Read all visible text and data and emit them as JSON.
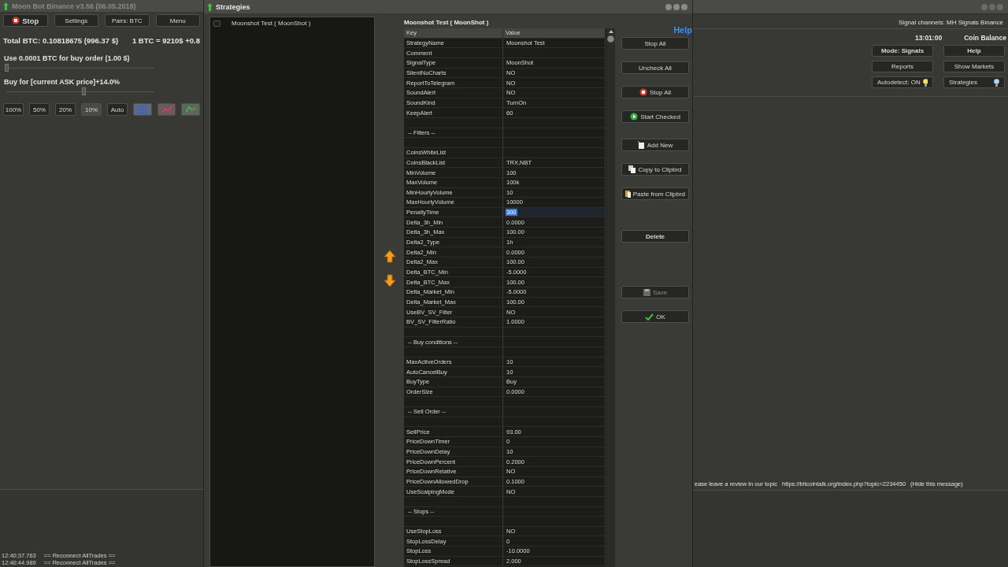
{
  "main_window": {
    "title": "Moon Bot Binance v3.56 (06.05.2018)",
    "toolbar": [
      {
        "label": "Stop",
        "kind": "stop"
      },
      {
        "label": "Settings",
        "kind": "plain"
      },
      {
        "label": "Pairs: BTC",
        "kind": "plain"
      },
      {
        "label": "Menu",
        "kind": "plain"
      }
    ],
    "total_btc": "Total BTC: 0.10818675 (996.37 $)",
    "btc_price": "1 BTC = 9210$  +0.8",
    "sliders": [
      {
        "label": "Use 0.0001 BTC for buy order  (1.00 $)",
        "level": 0.0
      },
      {
        "label": "Buy for [current ASK price]+14.0%",
        "level": 0.52
      }
    ],
    "percent_buttons": [
      {
        "label": "100%",
        "selected": false
      },
      {
        "label": "50%",
        "selected": false
      },
      {
        "label": "20%",
        "selected": false
      },
      {
        "label": "10%",
        "selected": true
      },
      {
        "label": "Auto",
        "selected": false
      }
    ],
    "log": [
      {
        "time": "12:40:37.763",
        "message": "== Reconnect AllTrades =="
      },
      {
        "time": "12:40:44.989",
        "message": "== Reconnect AllTrades =="
      }
    ],
    "signal_channels": "Signal channels: MH Signals Binance",
    "clock": "13:01:00",
    "coin_balance": "Coin Balance",
    "side_buttons": [
      {
        "label": "Mode: Signals",
        "bold": true,
        "kind": "plain"
      },
      {
        "label": "Help",
        "bold": true,
        "kind": "plain"
      },
      {
        "label": "Reports",
        "bold": false,
        "kind": "plain"
      },
      {
        "label": "Show Markets",
        "bold": false,
        "kind": "plain"
      },
      {
        "label": "Autodetect: ON",
        "bold": false,
        "kind": "bulb",
        "color": "#f3de6a"
      },
      {
        "label": "Strategies",
        "bold": false,
        "kind": "bulb",
        "color": "#a9d4f5"
      }
    ],
    "notice": {
      "text": "ease leave a review in our topic",
      "link": "https://bitcointalk.org/index.php?topic=2234450",
      "hide": "(Hide this message)"
    }
  },
  "strategies_window": {
    "title": "Strategies",
    "strategies": [
      {
        "name": "Moonshot Test  ( MoonShot )",
        "checked": false
      }
    ],
    "heading": "Moonshot Test  ( MoonShot )",
    "help": "Help",
    "table": {
      "columns": [
        "Key",
        "Value"
      ],
      "rows": [
        {
          "kind": "param",
          "key": "StrategyName",
          "value": "Moonshot Test",
          "selected": false
        },
        {
          "kind": "param",
          "key": "Comment",
          "selected": false
        },
        {
          "kind": "param",
          "key": "SignalType",
          "value": "MoonShot",
          "selected": false
        },
        {
          "kind": "param",
          "key": "SilentNoCharts",
          "value": "NO",
          "selected": false
        },
        {
          "kind": "param",
          "key": "ReportToTelegram",
          "value": "NO",
          "selected": false
        },
        {
          "kind": "param",
          "key": "SoundAlert",
          "value": "NO",
          "selected": false
        },
        {
          "kind": "param",
          "key": "SoundKind",
          "value": "TurnOn",
          "selected": false
        },
        {
          "kind": "param",
          "key": "KeepAlert",
          "value": "60",
          "selected": false
        },
        {
          "kind": "blank"
        },
        {
          "kind": "section",
          "key": "-- Filters --"
        },
        {
          "kind": "blank"
        },
        {
          "kind": "param",
          "key": "CoinsWhiteList",
          "selected": false
        },
        {
          "kind": "param",
          "key": "CoinsBlackList",
          "value": "TRX,NBT",
          "selected": false
        },
        {
          "kind": "param",
          "key": "MinVolume",
          "value": "100",
          "selected": false
        },
        {
          "kind": "param",
          "key": "MaxVolume",
          "value": "100k",
          "selected": false
        },
        {
          "kind": "param",
          "key": "MinHourlyVolume",
          "value": "10",
          "selected": false
        },
        {
          "kind": "param",
          "key": "MaxHourlyVolume",
          "value": "10000",
          "selected": false
        },
        {
          "kind": "param",
          "key": "PenaltyTime",
          "value": "300",
          "selected": true
        },
        {
          "kind": "param",
          "key": "Delta_3h_Min",
          "value": "0.0000",
          "selected": false
        },
        {
          "kind": "param",
          "key": "Delta_3h_Max",
          "value": "100.00",
          "selected": false
        },
        {
          "kind": "param",
          "key": "Delta2_Type",
          "value": "1h",
          "selected": false
        },
        {
          "kind": "param",
          "key": "Delta2_Min",
          "value": "0.0000",
          "selected": false
        },
        {
          "kind": "param",
          "key": "Delta2_Max",
          "value": "100.00",
          "selected": false
        },
        {
          "kind": "param",
          "key": "Delta_BTC_Min",
          "value": "-5.0000",
          "selected": false
        },
        {
          "kind": "param",
          "key": "Delta_BTC_Max",
          "value": "100.00",
          "selected": false
        },
        {
          "kind": "param",
          "key": "Delta_Market_Min",
          "value": "-5.0000",
          "selected": false
        },
        {
          "kind": "param",
          "key": "Delta_Market_Max",
          "value": "100.00",
          "selected": false
        },
        {
          "kind": "param",
          "key": "UseBV_SV_Filter",
          "value": "NO",
          "selected": false
        },
        {
          "kind": "param",
          "key": "BV_SV_FilterRatio",
          "value": "1.0000",
          "selected": false
        },
        {
          "kind": "blank"
        },
        {
          "kind": "section",
          "key": "-- Buy conditions --"
        },
        {
          "kind": "blank"
        },
        {
          "kind": "param",
          "key": "MaxActiveOrders",
          "value": "10",
          "selected": false
        },
        {
          "kind": "param",
          "key": "AutoCancelBuy",
          "value": "10",
          "selected": false
        },
        {
          "kind": "param",
          "key": "BuyType",
          "value": "Buy",
          "selected": false
        },
        {
          "kind": "param",
          "key": "OrderSize",
          "value": "0.0000",
          "selected": false
        },
        {
          "kind": "blank"
        },
        {
          "kind": "section",
          "key": "-- Sell Order --"
        },
        {
          "kind": "blank"
        },
        {
          "kind": "param",
          "key": "SellPrice",
          "value": "93.00",
          "selected": false
        },
        {
          "kind": "param",
          "key": "PriceDownTimer",
          "value": "0",
          "selected": false
        },
        {
          "kind": "param",
          "key": "PriceDownDelay",
          "value": "10",
          "selected": false
        },
        {
          "kind": "param",
          "key": "PriceDownPercent",
          "value": "0.2000",
          "selected": false
        },
        {
          "kind": "param",
          "key": "PriceDownRelative",
          "value": "NO",
          "selected": false
        },
        {
          "kind": "param",
          "key": "PriceDownAllowedDrop",
          "value": "0.1000",
          "selected": false
        },
        {
          "kind": "param",
          "key": "UseScalpingMode",
          "value": "NO",
          "selected": false
        },
        {
          "kind": "blank"
        },
        {
          "kind": "section",
          "key": "-- Stops --"
        },
        {
          "kind": "blank"
        },
        {
          "kind": "param",
          "key": "UseStopLoss",
          "value": "NO",
          "selected": false
        },
        {
          "kind": "param",
          "key": "StopLossDelay",
          "value": "0",
          "selected": false
        },
        {
          "kind": "param",
          "key": "StopLoss",
          "value": "-10.0000",
          "selected": false
        },
        {
          "kind": "param",
          "key": "StopLossSpread",
          "value": "2.000",
          "selected": false
        }
      ]
    },
    "button_groups": [
      [
        {
          "label": "Stop All",
          "kind": "plain",
          "disabled": false
        },
        {
          "label": "Uncheck All",
          "kind": "plain",
          "disabled": false
        },
        {
          "label": "Stop All",
          "kind": "stop",
          "disabled": false
        },
        {
          "label": "Start Checked",
          "kind": "start",
          "disabled": false
        }
      ],
      [
        {
          "label": "Add New",
          "kind": "add",
          "disabled": false
        },
        {
          "label": "Copy to Clipbrd",
          "kind": "copy",
          "disabled": false
        },
        {
          "label": "Paste from Clipbrd",
          "kind": "paste",
          "disabled": false
        }
      ],
      [
        {
          "label": "Delete",
          "kind": "plain",
          "disabled": false
        }
      ],
      [
        {
          "label": "Save",
          "kind": "save",
          "disabled": true
        },
        {
          "label": "OK",
          "kind": "ok",
          "disabled": false
        }
      ]
    ]
  }
}
